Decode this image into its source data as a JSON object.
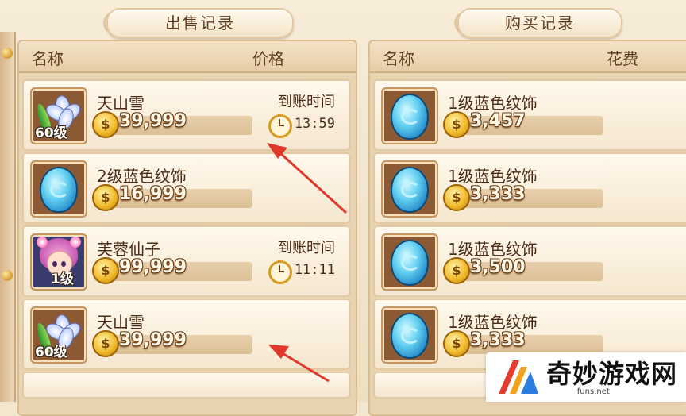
{
  "sell_panel": {
    "title": "出售记录",
    "header_name": "名称",
    "header_price": "价格",
    "rows": [
      {
        "name": "天山雪",
        "price": "39,999",
        "level": "60级",
        "icon": "snow-lotus-icon",
        "arrival_label": "到账时间",
        "time": "13:59"
      },
      {
        "name": "2级蓝色纹饰",
        "price": "16,999",
        "level": "",
        "icon": "blue-gem-icon",
        "arrival_label": "",
        "time": ""
      },
      {
        "name": "芙蓉仙子",
        "price": "99,999",
        "level": "1级",
        "icon": "fairy-portrait-icon",
        "arrival_label": "到账时间",
        "time": "11:11"
      },
      {
        "name": "天山雪",
        "price": "39,999",
        "level": "60级",
        "icon": "snow-lotus-icon",
        "arrival_label": "",
        "time": ""
      }
    ]
  },
  "buy_panel": {
    "title": "购买记录",
    "header_name": "名称",
    "header_cost": "花费",
    "rows": [
      {
        "name": "1级蓝色纹饰",
        "price": "3,457",
        "icon": "blue-gem-icon"
      },
      {
        "name": "1级蓝色纹饰",
        "price": "3,333",
        "icon": "blue-gem-icon"
      },
      {
        "name": "1级蓝色纹饰",
        "price": "3,500",
        "icon": "blue-gem-icon"
      },
      {
        "name": "1级蓝色纹饰",
        "price": "3,333",
        "icon": "blue-gem-icon"
      }
    ]
  },
  "watermark": {
    "name": "奇妙游戏网",
    "url": "ifuns.net"
  },
  "colors": {
    "accent_arrow": "#e0392b",
    "coin": "#f0b726",
    "text_brown": "#4a2b16"
  }
}
